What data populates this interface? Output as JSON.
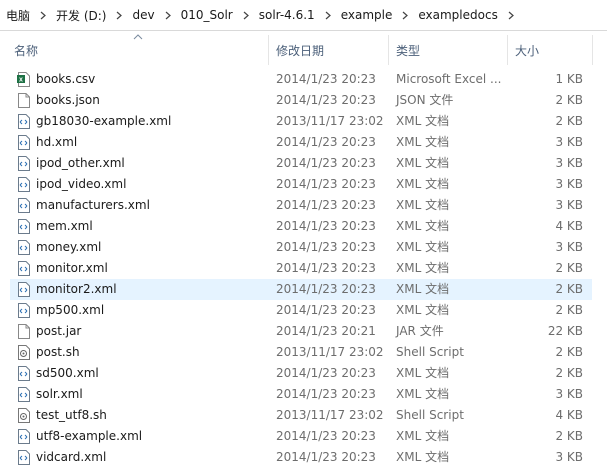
{
  "address": {
    "crumbs": [
      "电脑",
      "开发 (D:)",
      "dev",
      "010_Solr",
      "solr-4.6.1",
      "example",
      "exampledocs"
    ]
  },
  "columns": {
    "name": "名称",
    "date": "修改日期",
    "type": "类型",
    "size": "大小"
  },
  "files": [
    {
      "name": "books.csv",
      "date": "2014/1/23 20:23",
      "type": "Microsoft Excel ...",
      "size": "1 KB",
      "icon": "excel-csv-icon"
    },
    {
      "name": "books.json",
      "date": "2014/1/23 20:23",
      "type": "JSON 文件",
      "size": "2 KB",
      "icon": "blank-file-icon"
    },
    {
      "name": "gb18030-example.xml",
      "date": "2013/11/17 23:02",
      "type": "XML 文档",
      "size": "2 KB",
      "icon": "xml-file-icon"
    },
    {
      "name": "hd.xml",
      "date": "2014/1/23 20:23",
      "type": "XML 文档",
      "size": "3 KB",
      "icon": "xml-file-icon"
    },
    {
      "name": "ipod_other.xml",
      "date": "2014/1/23 20:23",
      "type": "XML 文档",
      "size": "3 KB",
      "icon": "xml-file-icon"
    },
    {
      "name": "ipod_video.xml",
      "date": "2014/1/23 20:23",
      "type": "XML 文档",
      "size": "3 KB",
      "icon": "xml-file-icon"
    },
    {
      "name": "manufacturers.xml",
      "date": "2014/1/23 20:23",
      "type": "XML 文档",
      "size": "3 KB",
      "icon": "xml-file-icon"
    },
    {
      "name": "mem.xml",
      "date": "2014/1/23 20:23",
      "type": "XML 文档",
      "size": "4 KB",
      "icon": "xml-file-icon"
    },
    {
      "name": "money.xml",
      "date": "2014/1/23 20:23",
      "type": "XML 文档",
      "size": "3 KB",
      "icon": "xml-file-icon"
    },
    {
      "name": "monitor.xml",
      "date": "2014/1/23 20:23",
      "type": "XML 文档",
      "size": "2 KB",
      "icon": "xml-file-icon"
    },
    {
      "name": "monitor2.xml",
      "date": "2014/1/23 20:23",
      "type": "XML 文档",
      "size": "2 KB",
      "icon": "xml-file-icon",
      "selected": true
    },
    {
      "name": "mp500.xml",
      "date": "2014/1/23 20:23",
      "type": "XML 文档",
      "size": "2 KB",
      "icon": "xml-file-icon"
    },
    {
      "name": "post.jar",
      "date": "2014/1/23 20:21",
      "type": "JAR 文件",
      "size": "22 KB",
      "icon": "blank-file-icon"
    },
    {
      "name": "post.sh",
      "date": "2013/11/17 23:02",
      "type": "Shell Script",
      "size": "2 KB",
      "icon": "script-file-icon"
    },
    {
      "name": "sd500.xml",
      "date": "2014/1/23 20:23",
      "type": "XML 文档",
      "size": "2 KB",
      "icon": "xml-file-icon"
    },
    {
      "name": "solr.xml",
      "date": "2014/1/23 20:23",
      "type": "XML 文档",
      "size": "3 KB",
      "icon": "xml-file-icon"
    },
    {
      "name": "test_utf8.sh",
      "date": "2013/11/17 23:02",
      "type": "Shell Script",
      "size": "4 KB",
      "icon": "script-file-icon"
    },
    {
      "name": "utf8-example.xml",
      "date": "2014/1/23 20:23",
      "type": "XML 文档",
      "size": "2 KB",
      "icon": "xml-file-icon"
    },
    {
      "name": "vidcard.xml",
      "date": "2014/1/23 20:23",
      "type": "XML 文档",
      "size": "3 KB",
      "icon": "xml-file-icon"
    }
  ],
  "colors": {
    "header_text": "#4c607a",
    "secondary_text": "#6d6d6d",
    "selection": "#e5f3ff",
    "excel_green": "#1e7145"
  }
}
